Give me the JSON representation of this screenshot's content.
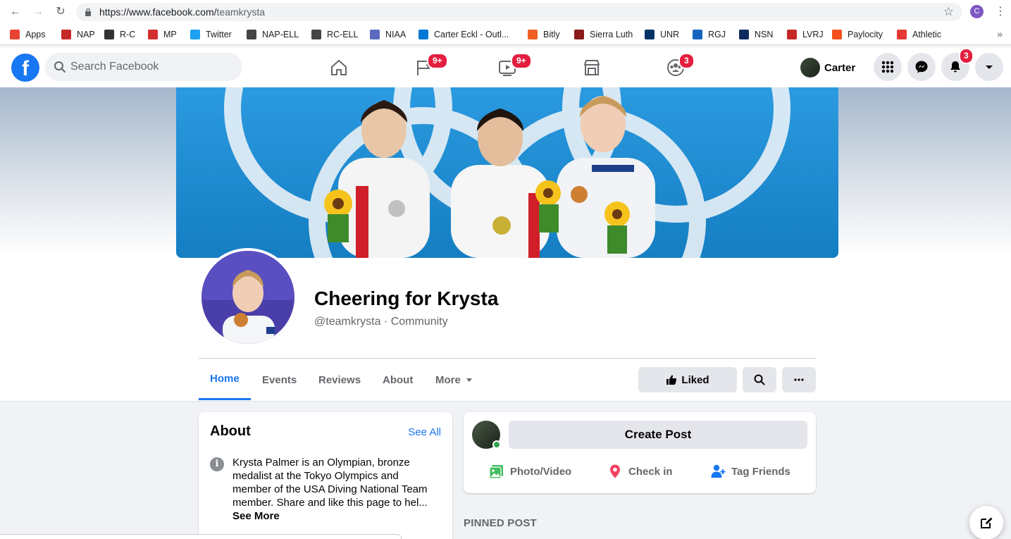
{
  "browser": {
    "url_host": "https://www.facebook.com/",
    "url_path": "teamkrysta",
    "profile_initial": "C",
    "bookmarks": [
      {
        "label": "Apps",
        "color": "#ea4335"
      },
      {
        "label": "NAP",
        "color": "#c62828"
      },
      {
        "label": "R-C",
        "color": "#333333"
      },
      {
        "label": "MP",
        "color": "#d32f2f"
      },
      {
        "label": "Twitter",
        "color": "#1da1f2"
      },
      {
        "label": "NAP-ELL",
        "color": "#444444"
      },
      {
        "label": "RC-ELL",
        "color": "#444444"
      },
      {
        "label": "NIAA",
        "color": "#5c6bc0"
      },
      {
        "label": "Carter Eckl - Outl...",
        "color": "#0078d4"
      },
      {
        "label": "Bitly",
        "color": "#ee6123"
      },
      {
        "label": "Sierra Luth",
        "color": "#8b1a1a"
      },
      {
        "label": "UNR",
        "color": "#003366"
      },
      {
        "label": "RGJ",
        "color": "#1565c0"
      },
      {
        "label": "NSN",
        "color": "#0d2b5c"
      },
      {
        "label": "LVRJ",
        "color": "#c62828"
      },
      {
        "label": "Paylocity",
        "color": "#f4511e"
      },
      {
        "label": "Athletic",
        "color": "#e53935"
      }
    ],
    "more_bookmarks": "»"
  },
  "header": {
    "search_placeholder": "Search Facebook",
    "nav": [
      {
        "name": "home",
        "icon": "home-icon",
        "badge": ""
      },
      {
        "name": "pages",
        "icon": "flag-icon",
        "badge": "9+"
      },
      {
        "name": "watch",
        "icon": "video-icon",
        "badge": "9+"
      },
      {
        "name": "marketplace",
        "icon": "store-icon",
        "badge": ""
      },
      {
        "name": "groups",
        "icon": "groups-icon",
        "badge": "3"
      }
    ],
    "user_name": "Carter",
    "notifications_badge": "3"
  },
  "page": {
    "name": "Cheering for Krysta",
    "handle": "@teamkrysta · Community",
    "tabs": [
      "Home",
      "Events",
      "Reviews",
      "About",
      "More"
    ],
    "active_tab": "Home",
    "liked_label": "Liked"
  },
  "about": {
    "title": "About",
    "see_all": "See All",
    "text": "Krysta Palmer is an Olympian, bronze medalist at the Tokyo Olympics and member of the USA Diving National Team member. Share and like this page to hel...",
    "see_more": "See More"
  },
  "create_post": {
    "button": "Create Post",
    "actions": [
      "Photo/Video",
      "Check in",
      "Tag Friends"
    ]
  },
  "feed": {
    "pinned_label": "PINNED POST"
  },
  "colors": {
    "fb_blue": "#1877f2",
    "badge_red": "#e41e3f",
    "online_green": "#31a24c"
  }
}
